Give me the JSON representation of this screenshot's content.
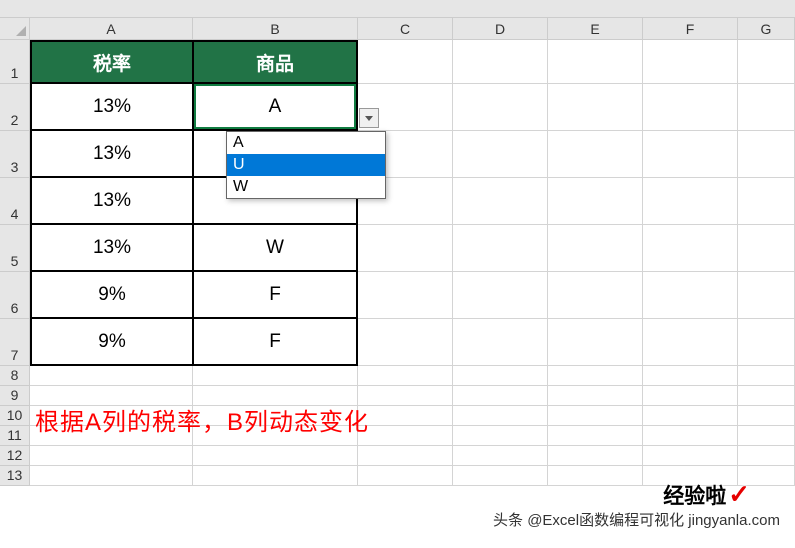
{
  "columns": [
    "A",
    "B",
    "C",
    "D",
    "E",
    "F",
    "G"
  ],
  "rows": [
    "1",
    "2",
    "3",
    "4",
    "5",
    "6",
    "7",
    "8",
    "9",
    "10",
    "11",
    "12",
    "13"
  ],
  "headers": {
    "A": "税率",
    "B": "商品"
  },
  "data": [
    {
      "rate": "13%",
      "item": "A"
    },
    {
      "rate": "13%",
      "item": ""
    },
    {
      "rate": "13%",
      "item": ""
    },
    {
      "rate": "13%",
      "item": "W"
    },
    {
      "rate": "9%",
      "item": "F"
    },
    {
      "rate": "9%",
      "item": "F"
    }
  ],
  "dropdown": {
    "options": [
      "A",
      "U",
      "W"
    ],
    "selected": "U"
  },
  "annotation": "根据A列的税率，B列动态变化",
  "watermark1": "经验啦",
  "watermark2": "头条 @Excel函数编程可视化 jingyanla.com"
}
